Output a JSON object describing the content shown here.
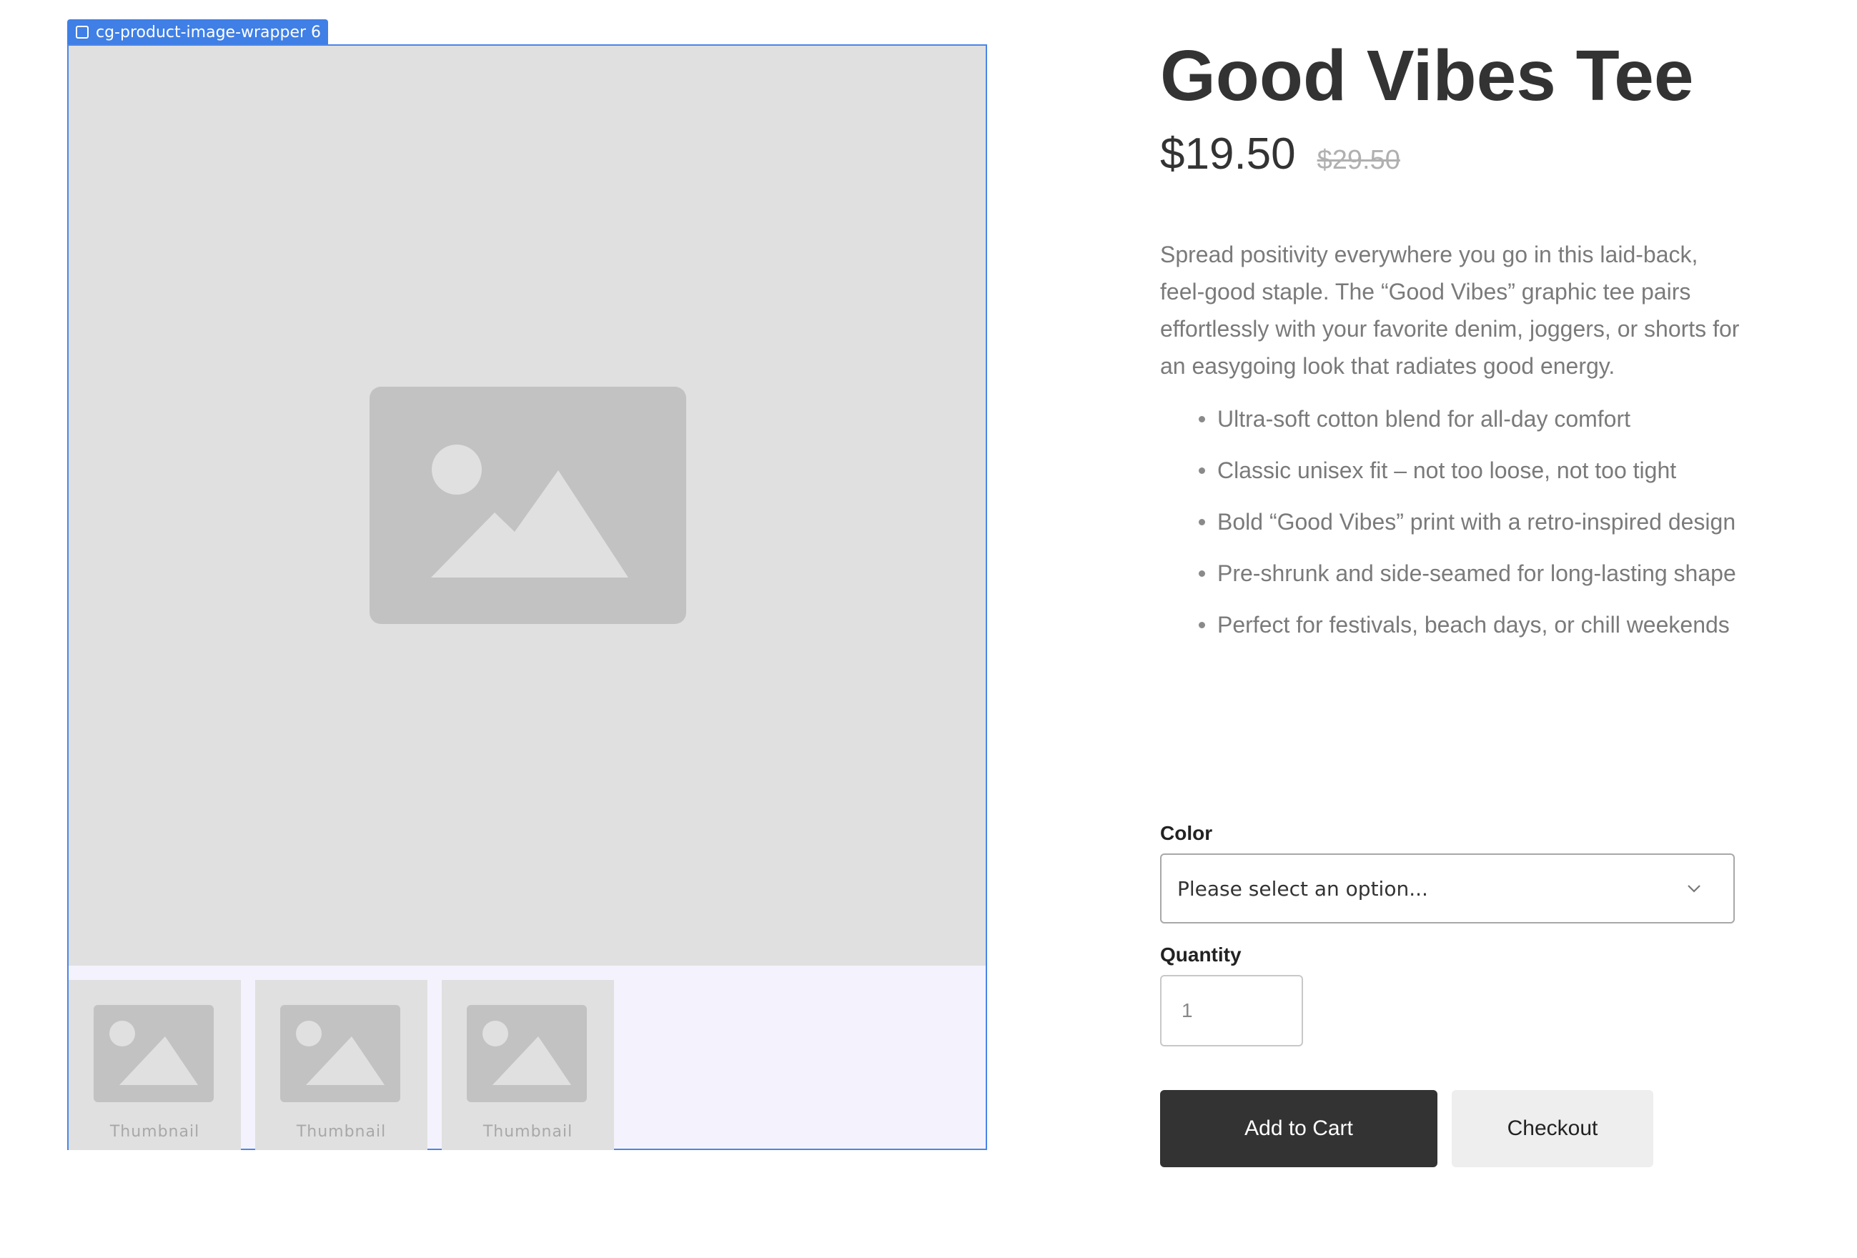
{
  "editor": {
    "wrapper_tag": "cg-product-image-wrapper 6"
  },
  "gallery": {
    "thumbnails": [
      {
        "label": "Thumbnail"
      },
      {
        "label": "Thumbnail"
      },
      {
        "label": "Thumbnail"
      }
    ]
  },
  "product": {
    "title": "Good Vibes Tee",
    "price": "$19.50",
    "old_price": "$29.50",
    "description": "Spread positivity everywhere you go in this laid-back, feel-good staple. The “Good Vibes” graphic tee pairs effortlessly with your favorite denim, joggers, or shorts for an easygoing look that radiates good energy.",
    "features": [
      "Ultra-soft cotton blend for all-day comfort",
      "Classic unisex fit – not too loose, not too tight",
      "Bold “Good Vibes” print with a retro-inspired design",
      "Pre-shrunk and side-seamed for long-lasting shape",
      "Perfect for festivals, beach days, or chill weekends"
    ]
  },
  "form": {
    "color_label": "Color",
    "color_placeholder": "Please select an option...",
    "quantity_label": "Quantity",
    "quantity_value": "1",
    "add_to_cart_label": "Add to Cart",
    "checkout_label": "Checkout"
  },
  "colors": {
    "accent": "#3f7fe6",
    "primary_button": "#333333",
    "secondary_button": "#eeeeee",
    "placeholder": "#e0e0e0"
  }
}
